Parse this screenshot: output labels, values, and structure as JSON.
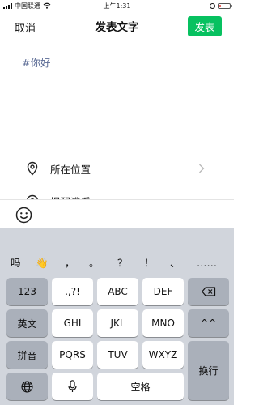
{
  "status_bar": {
    "carrier": "中国联通",
    "time": "上午1:31",
    "battery_level": 0.15,
    "battery_color": "#e53935"
  },
  "nav": {
    "cancel_label": "取消",
    "title": "发表文字",
    "publish_label": "发表",
    "publish_color": "#07c160"
  },
  "editor": {
    "text": "#你好"
  },
  "options": {
    "location_label": "所在位置",
    "mention_label": "提醒谁看"
  },
  "keyboard": {
    "candidates": [
      "吗",
      "👋",
      "，",
      "。",
      "？",
      "！",
      "、",
      "……"
    ],
    "keys": {
      "num": "123",
      "punct": ".,?!",
      "abc": "ABC",
      "def": "DEF",
      "en": "英文",
      "ghi": "GHI",
      "jkl": "JKL",
      "mno": "MNO",
      "face": "^^",
      "pinyin": "拼音",
      "pqrs": "PQRS",
      "tuv": "TUV",
      "wxyz": "WXYZ",
      "newline": "换行",
      "space": "空格"
    }
  },
  "icons": {
    "location": "location-pin-icon",
    "mention": "at-mention-icon",
    "emoji": "emoji-face-icon",
    "delete": "backspace-icon",
    "globe": "globe-icon",
    "mic": "microphone-icon"
  }
}
